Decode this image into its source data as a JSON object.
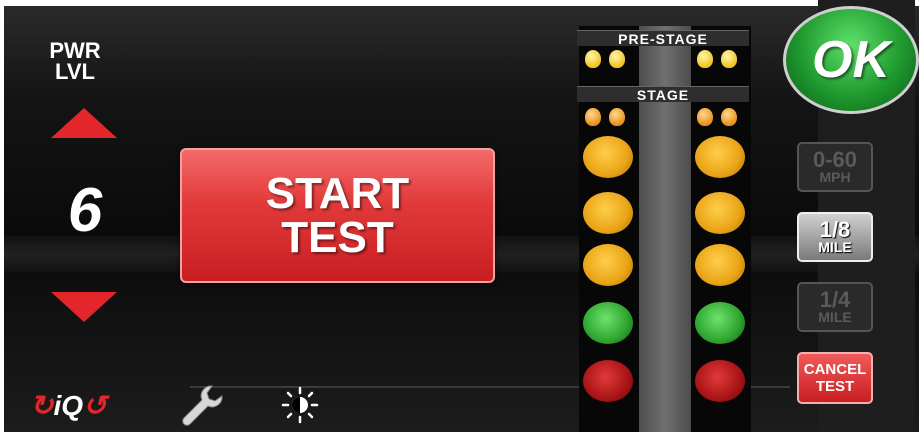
{
  "power": {
    "label_line1": "PWR",
    "label_line2": "LVL",
    "level": "6"
  },
  "start_button": {
    "line1": "START",
    "line2": "TEST"
  },
  "tree": {
    "prestage_label": "PRE-STAGE",
    "stage_label": "STAGE"
  },
  "ok_button": {
    "label": "OK"
  },
  "modes": [
    {
      "line1": "0-60",
      "line2": "MPH",
      "state": "disabled"
    },
    {
      "line1": "1/8",
      "line2": "MILE",
      "state": "selected"
    },
    {
      "line1": "1/4",
      "line2": "MILE",
      "state": "disabled"
    }
  ],
  "cancel_button": {
    "line1": "CANCEL",
    "line2": "TEST"
  },
  "logo": {
    "text_a": "i",
    "text_b": "Q"
  },
  "icons": {
    "wrench": "wrench-icon",
    "brightness": "brightness-icon",
    "up": "arrow-up-icon",
    "down": "arrow-down-icon"
  },
  "colors": {
    "accent": "#e2262b",
    "ok_green": "#1f9a2f"
  }
}
